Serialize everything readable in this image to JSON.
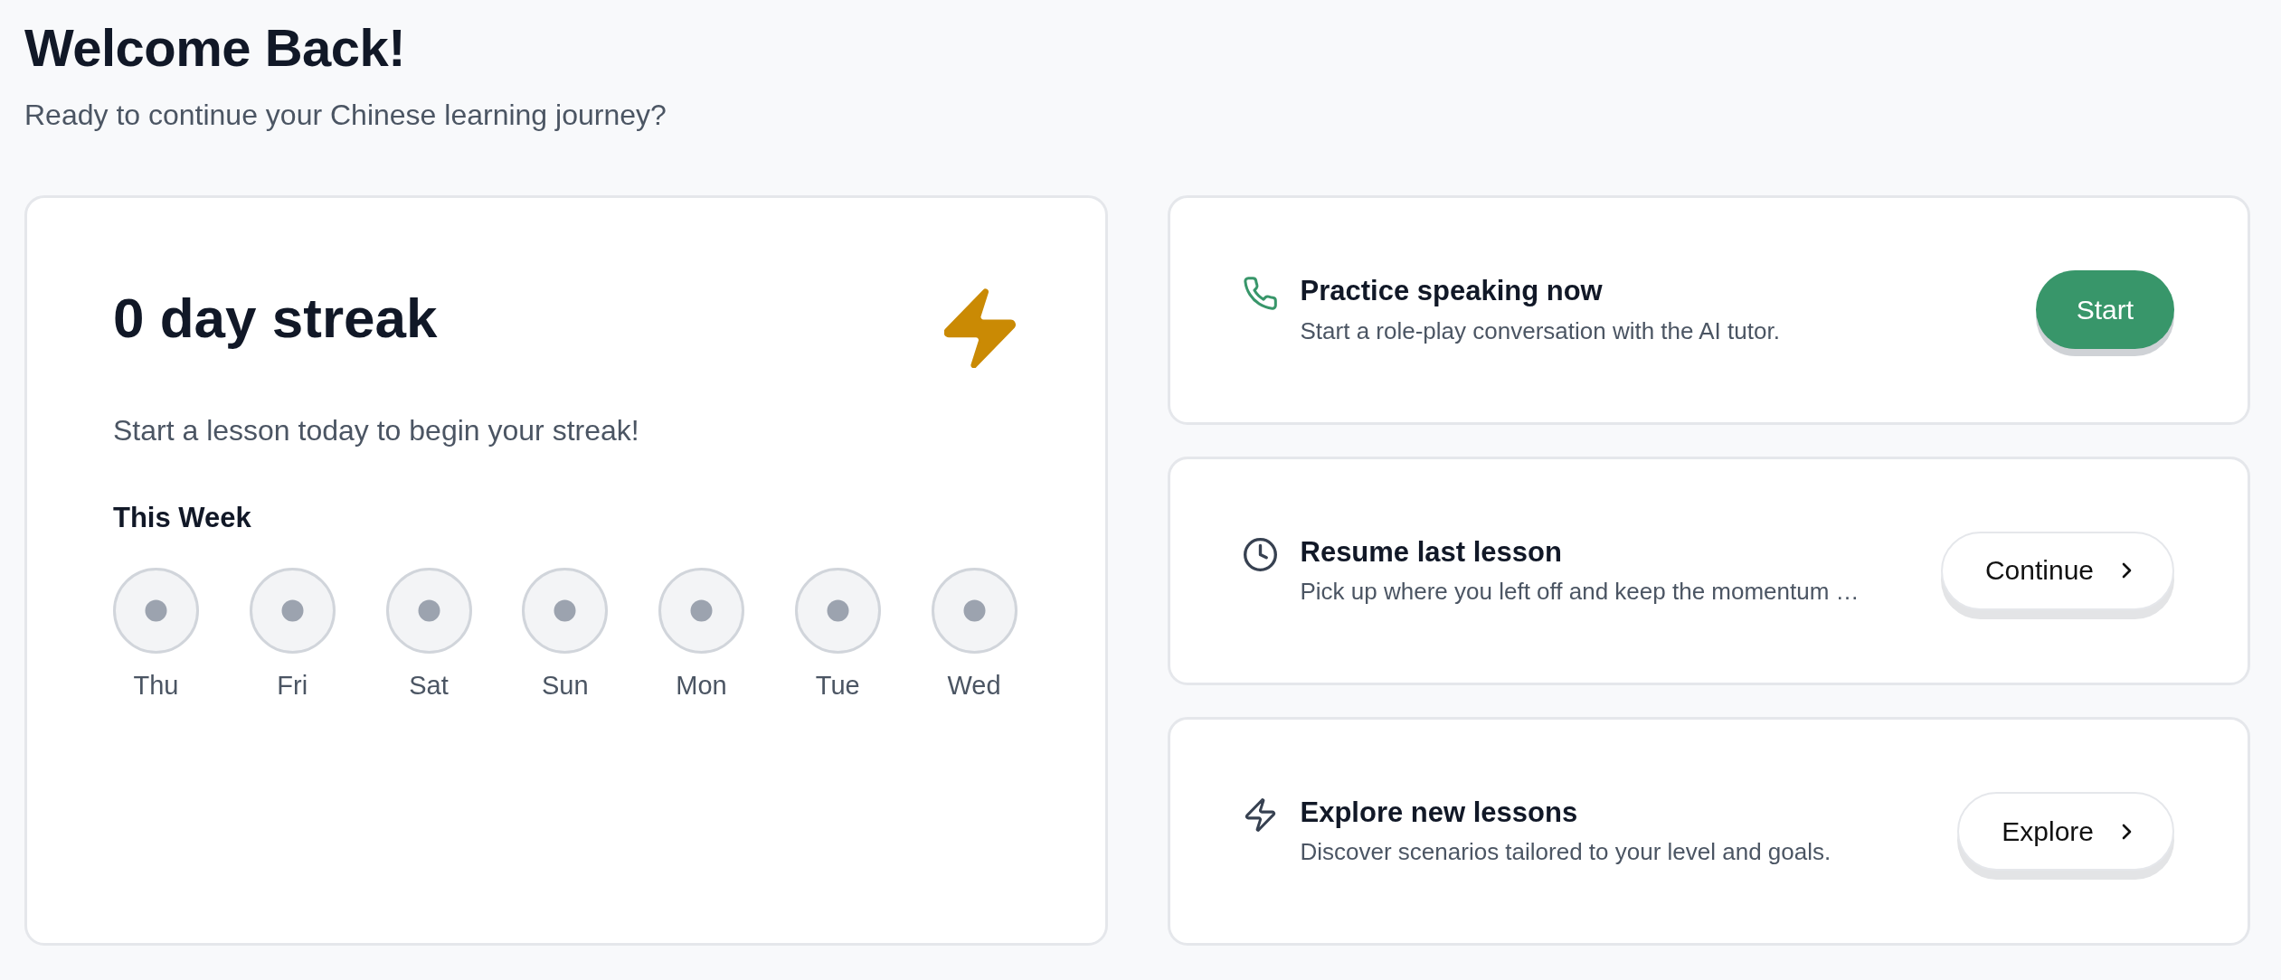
{
  "header": {
    "title": "Welcome Back!",
    "subtitle": "Ready to continue your Chinese learning journey?"
  },
  "streak": {
    "title": "0 day streak",
    "message": "Start a lesson today to begin your streak!",
    "week_label": "This Week",
    "days": [
      {
        "label": "Thu",
        "completed": false
      },
      {
        "label": "Fri",
        "completed": false
      },
      {
        "label": "Sat",
        "completed": false
      },
      {
        "label": "Sun",
        "completed": false
      },
      {
        "label": "Mon",
        "completed": false
      },
      {
        "label": "Tue",
        "completed": false
      },
      {
        "label": "Wed",
        "completed": false
      }
    ]
  },
  "actions": [
    {
      "kind": "speaking",
      "title": "Practice speaking now",
      "description": "Start a role-play conversation with the AI tutor.",
      "button": {
        "label": "Start",
        "primary": true
      }
    },
    {
      "kind": "resume",
      "title": "Resume last lesson",
      "description": "Pick up where you left off and keep the momentum …",
      "button": {
        "label": "Continue",
        "primary": false
      }
    },
    {
      "kind": "explore",
      "title": "Explore new lessons",
      "description": "Discover scenarios tailored to your level and goals.",
      "button": {
        "label": "Explore",
        "primary": false
      }
    }
  ]
}
